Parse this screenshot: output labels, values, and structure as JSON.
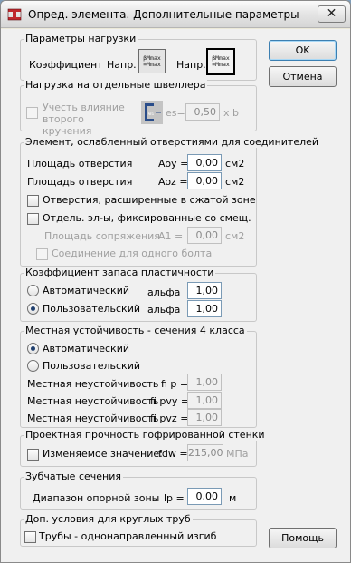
{
  "window": {
    "title": "Опред. элемента. Дополнительные параметры",
    "close": "✕"
  },
  "buttons": {
    "ok": "OK",
    "cancel": "Отмена",
    "help": "Помощь"
  },
  "load_params": {
    "title": "Параметры нагрузки",
    "coef_label": "Коэффициент",
    "dir1_label": "Напр.",
    "dir1_formula": [
      "βMmax",
      "=Mmax"
    ],
    "dir2_label": "Напр.",
    "dir2_formula": [
      "βMmax",
      "=Mmax"
    ]
  },
  "channel": {
    "title": "Нагрузка на отдельные швеллера",
    "torsion_label": "Учесть влияние второго кручения",
    "es_label": "es=",
    "es_value": "0,50",
    "es_unit": "x b",
    "icon_label": "e₁"
  },
  "holes": {
    "title": "Элемент, ослабленный отверстиями для соединителей",
    "area_label_1": "Площадь отверстия",
    "aoy_label": "Aoy =",
    "aoy_value": "0,00",
    "aoy_unit": "см2",
    "area_label_2": "Площадь отверстия",
    "aoz_label": "Aoz =",
    "aoz_value": "0,00",
    "aoz_unit": "см2",
    "expanded_label": "Отверстия, расширенные в сжатой зоне",
    "offset_label": "Отдель. эл-ы, фиксированные со смещ.",
    "junction_label": "Площадь сопряжения",
    "a1_label": "A1 =",
    "a1_value": "0,00",
    "a1_unit": "см2",
    "one_bolt_label": "Соединение для одного болта"
  },
  "plasticity": {
    "title": "Коэффициент запаса пластичности",
    "auto_label": "Автоматический",
    "auto_alpha_label": "альфа",
    "auto_alpha_value": "1,00",
    "user_label": "Пользовательский",
    "user_alpha_label": "альфа",
    "user_alpha_value": "1,00",
    "selected": "user"
  },
  "stability": {
    "title": "Местная устойчивость - сечения 4 класса",
    "auto_label": "Автоматический",
    "user_label": "Пользовательский",
    "selected": "auto",
    "rows": [
      {
        "label": "Местная неустойчивость",
        "param": "fi p =",
        "value": "1,00"
      },
      {
        "label": "Местная неустойчивость",
        "param": "fi pvy =",
        "value": "1,00"
      },
      {
        "label": "Местная неустойчивость",
        "param": "fi pvz =",
        "value": "1,00"
      }
    ]
  },
  "corrugated": {
    "title": "Проектная прочность гофрированной стенки",
    "variable_label": "Изменяемое значение:",
    "fdw_label": "fdw =",
    "fdw_value": "215,00",
    "fdw_unit": "МПа"
  },
  "toothed": {
    "title": "Зубчатые сечения",
    "range_label": "Диапазон опорной зоны",
    "lp_label": "lp =",
    "lp_value": "0,00",
    "lp_unit": "м"
  },
  "round_pipes": {
    "title": "Доп. условия для круглых труб",
    "pipes_label": "Трубы - однонаправленный изгиб"
  },
  "colors": {
    "window_bg": "#f0f0f0",
    "field_border": "#7a9ab5",
    "default_button_border": "#3c7fb1"
  }
}
